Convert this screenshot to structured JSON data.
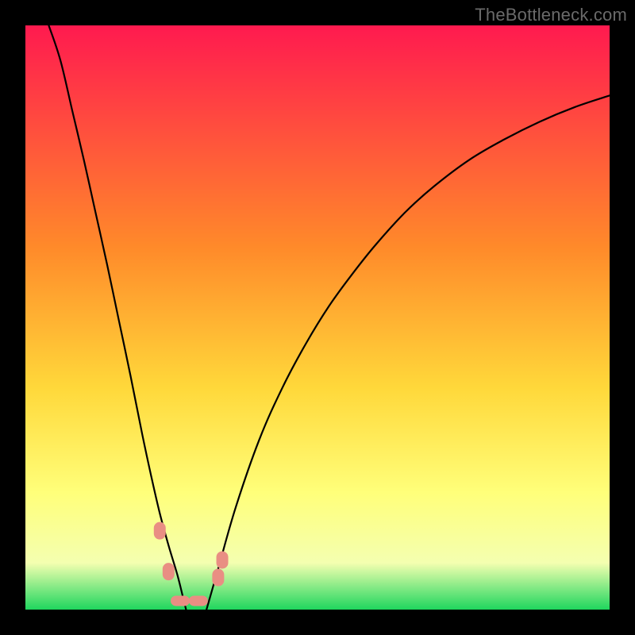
{
  "watermark": "TheBottleneck.com",
  "chart_data": {
    "type": "line",
    "title": "",
    "xlabel": "",
    "ylabel": "",
    "xlim": [
      0,
      1
    ],
    "ylim": [
      0,
      1
    ],
    "background_gradient": {
      "top": "#ff1a4f",
      "mid1": "#ff8a2a",
      "mid2": "#ffd83a",
      "mid3": "#ffff7a",
      "mid4": "#f4ffb0",
      "bottom": "#1fd65e"
    },
    "series": [
      {
        "name": "left-branch",
        "x": [
          0.04,
          0.06,
          0.08,
          0.1,
          0.12,
          0.14,
          0.16,
          0.18,
          0.2,
          0.215,
          0.23,
          0.245,
          0.26,
          0.27,
          0.275
        ],
        "y": [
          1.0,
          0.94,
          0.855,
          0.77,
          0.68,
          0.59,
          0.495,
          0.4,
          0.3,
          0.23,
          0.165,
          0.11,
          0.06,
          0.02,
          0.0
        ]
      },
      {
        "name": "right-branch",
        "x": [
          0.31,
          0.33,
          0.36,
          0.4,
          0.44,
          0.48,
          0.52,
          0.56,
          0.6,
          0.65,
          0.7,
          0.76,
          0.82,
          0.88,
          0.94,
          1.0
        ],
        "y": [
          0.0,
          0.07,
          0.175,
          0.29,
          0.38,
          0.455,
          0.52,
          0.575,
          0.625,
          0.68,
          0.725,
          0.77,
          0.805,
          0.835,
          0.86,
          0.88
        ]
      }
    ],
    "markers": [
      {
        "name": "left-marker-1",
        "x": 0.23,
        "y": 0.135,
        "shape": "blob"
      },
      {
        "name": "left-marker-2",
        "x": 0.245,
        "y": 0.065,
        "shape": "blob"
      },
      {
        "name": "bottom-marker-1",
        "x": 0.265,
        "y": 0.015,
        "shape": "hbar"
      },
      {
        "name": "bottom-marker-2",
        "x": 0.296,
        "y": 0.015,
        "shape": "hbar"
      },
      {
        "name": "right-marker-1",
        "x": 0.33,
        "y": 0.055,
        "shape": "blob"
      },
      {
        "name": "right-marker-2",
        "x": 0.337,
        "y": 0.085,
        "shape": "blob"
      }
    ],
    "marker_color": "#e98e83",
    "curve_color": "#000000"
  }
}
